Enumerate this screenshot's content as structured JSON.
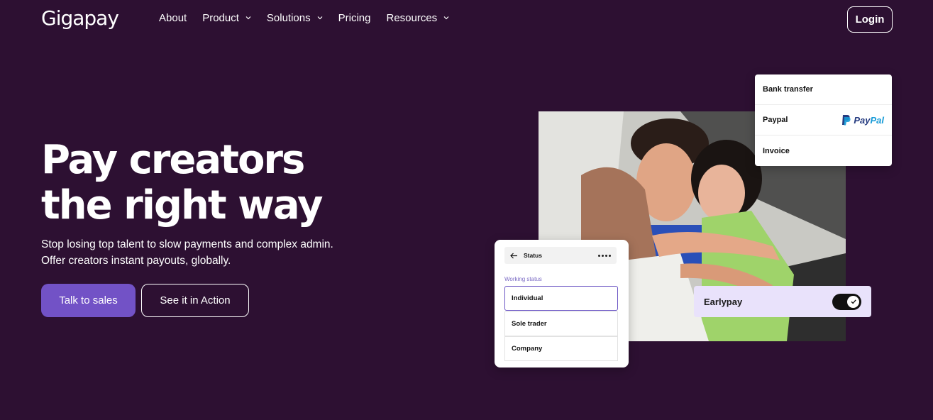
{
  "brand": {
    "logo_text": "Gigapay"
  },
  "nav": {
    "items": [
      {
        "label": "About",
        "has_dropdown": false
      },
      {
        "label": "Product",
        "has_dropdown": true
      },
      {
        "label": "Solutions",
        "has_dropdown": true
      },
      {
        "label": "Pricing",
        "has_dropdown": false
      },
      {
        "label": "Resources",
        "has_dropdown": true
      }
    ],
    "login_label": "Login"
  },
  "hero": {
    "title_line1": "Pay creators",
    "title_line2": "the right way",
    "subtitle_line1": "Stop losing top talent to slow payments and complex admin.",
    "subtitle_line2": "Offer creators instant payouts, globally.",
    "primary_cta": "Talk to sales",
    "secondary_cta": "See it in Action"
  },
  "payment_methods": {
    "rows": [
      {
        "label": "Bank transfer"
      },
      {
        "label": "Paypal",
        "logo_part1": "Pay",
        "logo_part2": "Pal"
      },
      {
        "label": "Invoice"
      }
    ]
  },
  "status_card": {
    "header": "Status",
    "section_label": "Working status",
    "options": [
      "Individual",
      "Sole trader",
      "Company"
    ],
    "selected": "Individual"
  },
  "earlypay": {
    "label": "Earlypay",
    "enabled": true
  },
  "colors": {
    "background": "#2d1032",
    "accent": "#7252c6",
    "earlypay_bg": "#e9e2fb",
    "paypal_dark": "#253b80",
    "paypal_light": "#179bd7"
  },
  "icons": [
    "chevron-down-icon",
    "back-arrow-icon",
    "more-dots-icon",
    "paypal-icon",
    "check-icon"
  ]
}
